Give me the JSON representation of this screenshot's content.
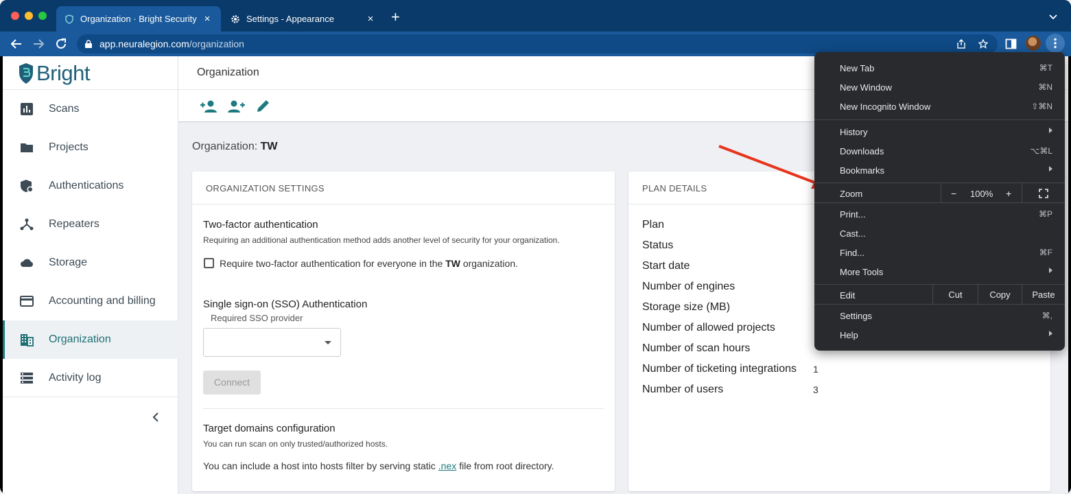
{
  "browser": {
    "tabs": [
      {
        "title": "Organization · Bright Security",
        "close": "×"
      },
      {
        "title": "Settings - Appearance",
        "close": "×"
      }
    ],
    "new_tab": "+",
    "url_host": "app.neuralegion.com",
    "url_path": "/organization"
  },
  "sidebar": {
    "logo_text": "Bright",
    "items": [
      {
        "label": "Scans",
        "icon": "bar-chart-icon"
      },
      {
        "label": "Projects",
        "icon": "folder-icon"
      },
      {
        "label": "Authentications",
        "icon": "shield-lock-icon"
      },
      {
        "label": "Repeaters",
        "icon": "hub-icon"
      },
      {
        "label": "Storage",
        "icon": "cloud-icon"
      },
      {
        "label": "Accounting and billing",
        "icon": "credit-card-icon"
      },
      {
        "label": "Organization",
        "icon": "building-icon"
      },
      {
        "label": "Activity log",
        "icon": "list-icon"
      }
    ]
  },
  "header": {
    "title": "Organization"
  },
  "org_line": {
    "prefix": "Organization: ",
    "name": "TW"
  },
  "org_settings": {
    "heading": "ORGANIZATION SETTINGS",
    "tfa_title": "Two-factor authentication",
    "tfa_desc": "Requiring an additional authentication method adds another level of security for your organization.",
    "tfa_check_pre": "Require two-factor authentication for everyone in the ",
    "tfa_check_org": "TW",
    "tfa_check_post": " organization.",
    "sso_title": "Single sign-on (SSO) Authentication",
    "sso_label": "Required SSO provider",
    "connect": "Connect",
    "domains_title": "Target domains configuration",
    "domains_desc": "You can run scan on only trusted/authorized hosts.",
    "host_pre": "You can include a host into hosts filter by serving static",
    "host_link": ".nex",
    "host_post": "file from root directory."
  },
  "plan": {
    "heading": "PLAN DETAILS",
    "rows": [
      {
        "label": "Plan",
        "value": ""
      },
      {
        "label": "Status",
        "value": ""
      },
      {
        "label": "Start date",
        "value": ""
      },
      {
        "label": "Number of engines",
        "value": ""
      },
      {
        "label": "Storage size (MB)",
        "value": ""
      },
      {
        "label": "Number of allowed projects",
        "value": ""
      },
      {
        "label": "Number of scan hours",
        "value": ""
      },
      {
        "label": "Number of ticketing integrations",
        "value": "1"
      },
      {
        "label": "Number of users",
        "value": "3"
      }
    ]
  },
  "menu": {
    "new_tab": "New Tab",
    "new_tab_sc": "⌘T",
    "new_window": "New Window",
    "new_window_sc": "⌘N",
    "incognito": "New Incognito Window",
    "incognito_sc": "⇧⌘N",
    "history": "History",
    "downloads": "Downloads",
    "downloads_sc": "⌥⌘L",
    "bookmarks": "Bookmarks",
    "zoom": "Zoom",
    "zoom_minus": "−",
    "zoom_value": "100%",
    "zoom_plus": "+",
    "print": "Print...",
    "print_sc": "⌘P",
    "cast": "Cast...",
    "find": "Find...",
    "find_sc": "⌘F",
    "more_tools": "More Tools",
    "edit": "Edit",
    "cut": "Cut",
    "copy": "Copy",
    "paste": "Paste",
    "settings": "Settings",
    "settings_sc": "⌘,",
    "help": "Help"
  },
  "colors": {
    "tabstrip": "#0a3a6a",
    "toolbar": "#1a5a9c",
    "accent_teal": "#1d7a7f",
    "menu_bg": "#292a2d",
    "annotation_arrow": "#e8341c"
  }
}
